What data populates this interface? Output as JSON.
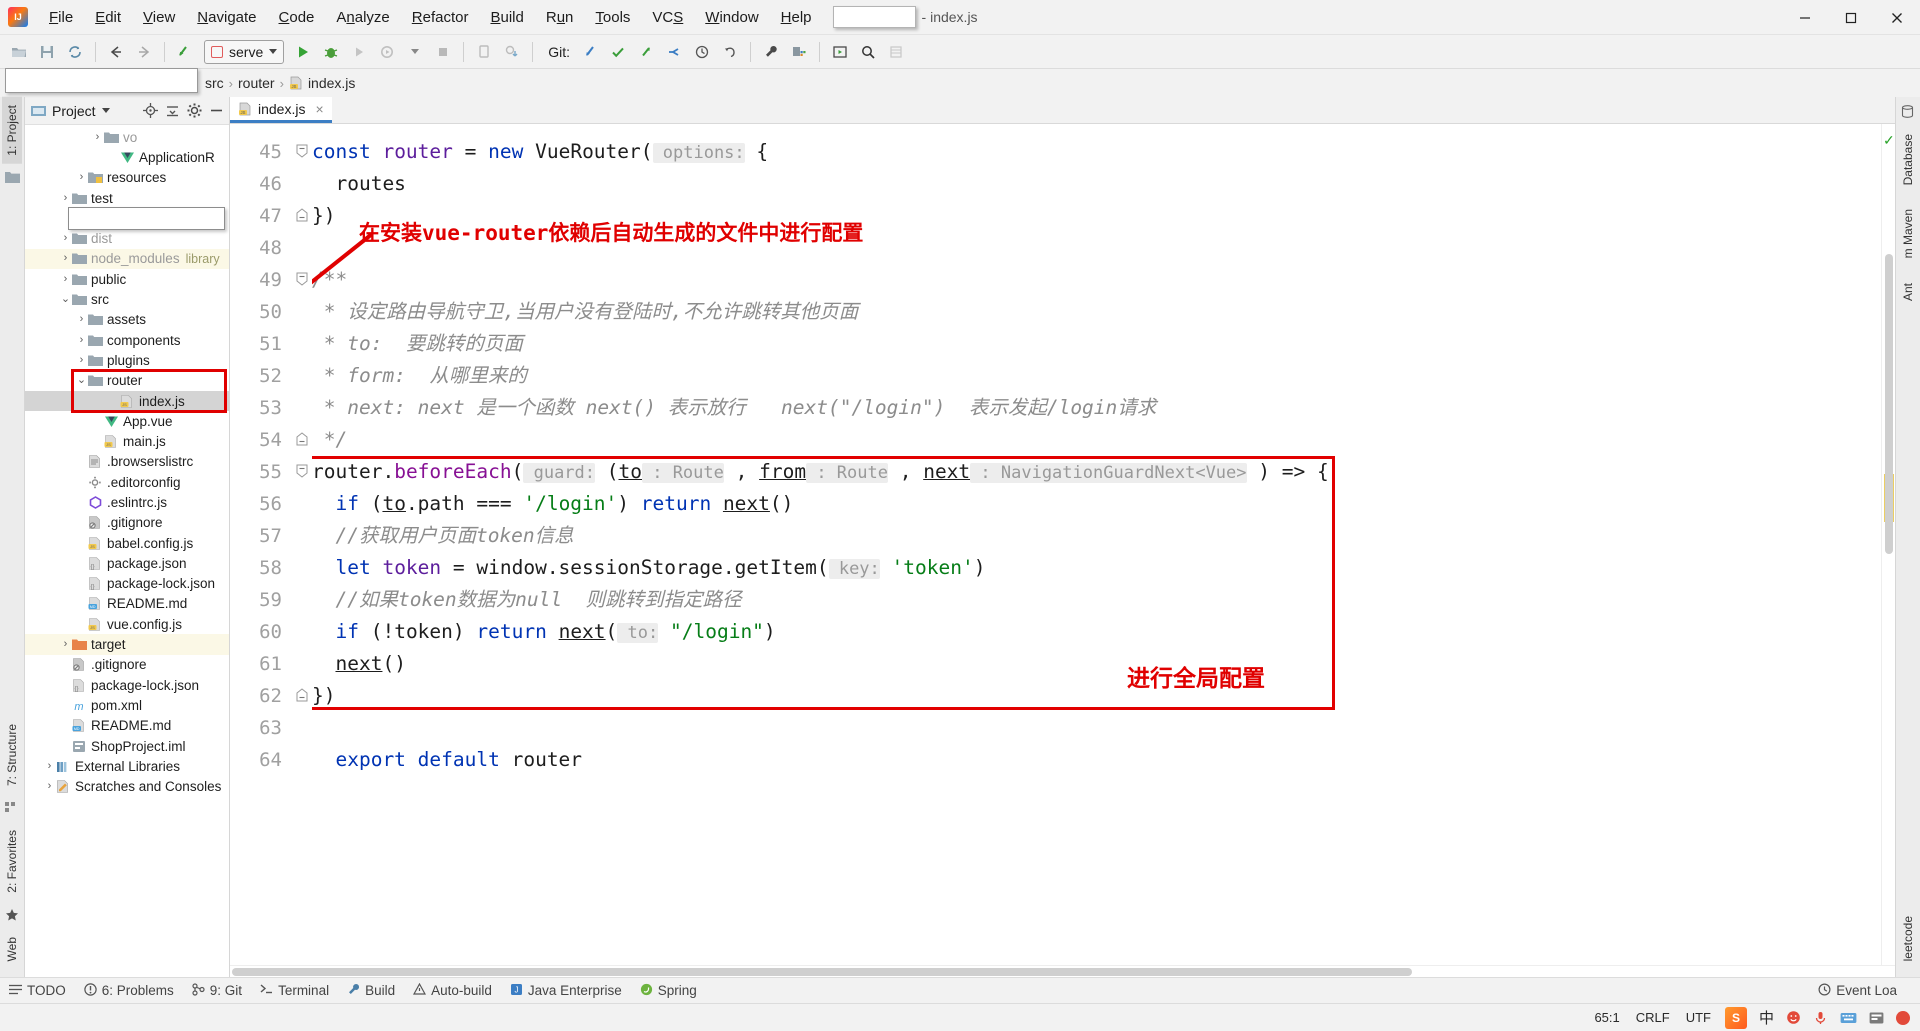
{
  "titlebar": {
    "logo_name": "intellij-idea-logo",
    "menus": [
      "File",
      "Edit",
      "View",
      "Navigate",
      "Code",
      "Analyze",
      "Refactor",
      "Build",
      "Run",
      "Tools",
      "VCS",
      "Window",
      "Help"
    ],
    "project_name_redacted": "",
    "title_suffix": "- index.js",
    "window_buttons": [
      "minimize",
      "maximize",
      "close"
    ]
  },
  "toolbar": {
    "run_config": "serve",
    "git_label": "Git:",
    "buttons": [
      "open-folder",
      "save-all",
      "sync",
      "back",
      "forward",
      "undo-arrow",
      "run",
      "debug",
      "run-coverage",
      "profile",
      "stop",
      "attach-debugger",
      "update-project",
      "commit",
      "update",
      "push",
      "history",
      "rollback",
      "settings-wrench",
      "project-structure",
      "terminal-run",
      "search-everywhere",
      "layout"
    ]
  },
  "breadcrumbs": {
    "redacted_field": "",
    "items": [
      "src",
      "router",
      "index.js"
    ],
    "separator": "›"
  },
  "left_strip": {
    "tabs": [
      "1: Project"
    ],
    "bottom_tabs": [
      "7: Structure",
      "2: Favorites"
    ],
    "web_tab": "Web"
  },
  "right_strip": {
    "tabs": [
      "Database",
      "m Maven",
      "Ant"
    ],
    "bottom_tabs": [
      "leetcode"
    ]
  },
  "project_panel": {
    "title": "Project",
    "header_icons": [
      "project-view-icon",
      "chevron-down-icon",
      "locate-icon",
      "collapse-all-icon",
      "settings-gear-icon",
      "hide-icon"
    ],
    "tree": [
      {
        "label": "vo",
        "indent": 4,
        "arrow": "›",
        "icon": "folder",
        "muted": true
      },
      {
        "label": "ApplicationR",
        "indent": 5,
        "arrow": "",
        "icon": "vue-green"
      },
      {
        "label": "resources",
        "indent": 3,
        "arrow": "›",
        "icon": "folder-res"
      },
      {
        "label": "test",
        "indent": 2,
        "arrow": "›",
        "icon": "folder"
      },
      {
        "label": "__REDACT__",
        "indent": 2,
        "arrow": "",
        "icon": "none"
      },
      {
        "label": "dist",
        "indent": 2,
        "arrow": "›",
        "icon": "folder",
        "muted": true
      },
      {
        "label": "node_modules",
        "indent": 2,
        "arrow": "›",
        "icon": "folder",
        "muted": true,
        "suffix": "library",
        "row_bg": "yellow"
      },
      {
        "label": "public",
        "indent": 2,
        "arrow": "›",
        "icon": "folder"
      },
      {
        "label": "src",
        "indent": 2,
        "arrow": "⌄",
        "icon": "folder"
      },
      {
        "label": "assets",
        "indent": 3,
        "arrow": "›",
        "icon": "folder"
      },
      {
        "label": "components",
        "indent": 3,
        "arrow": "›",
        "icon": "folder"
      },
      {
        "label": "plugins",
        "indent": 3,
        "arrow": "›",
        "icon": "folder"
      },
      {
        "label": "router",
        "indent": 3,
        "arrow": "⌄",
        "icon": "folder"
      },
      {
        "label": "index.js",
        "indent": 5,
        "arrow": "",
        "icon": "js",
        "selected": true
      },
      {
        "label": "App.vue",
        "indent": 4,
        "arrow": "",
        "icon": "vue"
      },
      {
        "label": "main.js",
        "indent": 4,
        "arrow": "",
        "icon": "js"
      },
      {
        "label": ".browserslistrc",
        "indent": 3,
        "arrow": "",
        "icon": "text"
      },
      {
        "label": ".editorconfig",
        "indent": 3,
        "arrow": "",
        "icon": "gear"
      },
      {
        "label": ".eslintrc.js",
        "indent": 3,
        "arrow": "",
        "icon": "eslint"
      },
      {
        "label": ".gitignore",
        "indent": 3,
        "arrow": "",
        "icon": "gitignore"
      },
      {
        "label": "babel.config.js",
        "indent": 3,
        "arrow": "",
        "icon": "js"
      },
      {
        "label": "package.json",
        "indent": 3,
        "arrow": "",
        "icon": "json"
      },
      {
        "label": "package-lock.json",
        "indent": 3,
        "arrow": "",
        "icon": "json"
      },
      {
        "label": "README.md",
        "indent": 3,
        "arrow": "",
        "icon": "md"
      },
      {
        "label": "vue.config.js",
        "indent": 3,
        "arrow": "",
        "icon": "js"
      },
      {
        "label": "target",
        "indent": 2,
        "arrow": "›",
        "icon": "folder-orange",
        "row_bg": "yellow"
      },
      {
        "label": ".gitignore",
        "indent": 2,
        "arrow": "",
        "icon": "gitignore"
      },
      {
        "label": "package-lock.json",
        "indent": 2,
        "arrow": "",
        "icon": "json"
      },
      {
        "label": "pom.xml",
        "indent": 2,
        "arrow": "",
        "icon": "maven"
      },
      {
        "label": "README.md",
        "indent": 2,
        "arrow": "",
        "icon": "md"
      },
      {
        "label": "ShopProject.iml",
        "indent": 2,
        "arrow": "",
        "icon": "iml"
      },
      {
        "label": "External Libraries",
        "indent": 1,
        "arrow": "›",
        "icon": "libs"
      },
      {
        "label": "Scratches and Consoles",
        "indent": 1,
        "arrow": "›",
        "icon": "scratch"
      }
    ]
  },
  "editor": {
    "tab": {
      "label": "index.js",
      "icon": "js-file-icon",
      "close": "×"
    },
    "first_line_number": 45,
    "lines": [
      {
        "n": 45,
        "fold": "start",
        "tokens": [
          {
            "t": "const ",
            "c": "kw"
          },
          {
            "t": "router",
            "c": "id"
          },
          {
            "t": " = ",
            "c": "plain"
          },
          {
            "t": "new ",
            "c": "kw"
          },
          {
            "t": "VueRouter",
            "c": "plain"
          },
          {
            "t": "(",
            "c": "plain"
          },
          {
            "t": " options:",
            "c": "hint"
          },
          {
            "t": " {",
            "c": "plain"
          }
        ]
      },
      {
        "n": 46,
        "tokens": [
          {
            "t": "  routes",
            "c": "plain"
          }
        ]
      },
      {
        "n": 47,
        "fold": "end",
        "tokens": [
          {
            "t": "})",
            "c": "plain"
          }
        ]
      },
      {
        "n": 48,
        "tokens": []
      },
      {
        "n": 49,
        "fold": "start",
        "tokens": [
          {
            "t": "/**",
            "c": "cmt"
          }
        ]
      },
      {
        "n": 50,
        "tokens": [
          {
            "t": " * 设定路由导航守卫,当用户没有登陆时,不允许跳转其他页面",
            "c": "cmt"
          }
        ]
      },
      {
        "n": 51,
        "tokens": [
          {
            "t": " * to:  要跳转的页面",
            "c": "cmt"
          }
        ]
      },
      {
        "n": 52,
        "tokens": [
          {
            "t": " * form:  从哪里来的",
            "c": "cmt"
          }
        ]
      },
      {
        "n": 53,
        "tokens": [
          {
            "t": " * next: next 是一个函数 next() 表示放行   next(\"/login\")  表示发起/login请求",
            "c": "cmt"
          }
        ]
      },
      {
        "n": 54,
        "fold": "end",
        "tokens": [
          {
            "t": " */",
            "c": "cmt"
          }
        ]
      },
      {
        "n": 55,
        "fold": "start",
        "tokens": [
          {
            "t": "router",
            "c": "plain"
          },
          {
            "t": ".",
            "c": "plain"
          },
          {
            "t": "beforeEach",
            "c": "purple"
          },
          {
            "t": "(",
            "c": "plain"
          },
          {
            "t": " guard:",
            "c": "hint"
          },
          {
            "t": " (",
            "c": "plain"
          },
          {
            "t": "to",
            "c": "und"
          },
          {
            "t": " : Route",
            "c": "hint"
          },
          {
            "t": " , ",
            "c": "plain"
          },
          {
            "t": "from",
            "c": "und"
          },
          {
            "t": " : Route",
            "c": "hint"
          },
          {
            "t": " , ",
            "c": "plain"
          },
          {
            "t": "next",
            "c": "und"
          },
          {
            "t": " : NavigationGuardNext<Vue>",
            "c": "hint"
          },
          {
            "t": " ) => {",
            "c": "plain"
          }
        ]
      },
      {
        "n": 56,
        "tokens": [
          {
            "t": "  ",
            "c": "plain"
          },
          {
            "t": "if",
            "c": "kw"
          },
          {
            "t": " (",
            "c": "plain"
          },
          {
            "t": "to",
            "c": "und"
          },
          {
            "t": ".path === ",
            "c": "plain"
          },
          {
            "t": "'/login'",
            "c": "str"
          },
          {
            "t": ") ",
            "c": "plain"
          },
          {
            "t": "return ",
            "c": "kw"
          },
          {
            "t": "next",
            "c": "und"
          },
          {
            "t": "()",
            "c": "plain"
          }
        ]
      },
      {
        "n": 57,
        "tokens": [
          {
            "t": "  //获取用户页面token信息",
            "c": "cmt"
          }
        ]
      },
      {
        "n": 58,
        "tokens": [
          {
            "t": "  ",
            "c": "plain"
          },
          {
            "t": "let ",
            "c": "kw"
          },
          {
            "t": "token",
            "c": "id"
          },
          {
            "t": " = window.sessionStorage.",
            "c": "plain"
          },
          {
            "t": "getItem",
            "c": "plain"
          },
          {
            "t": "(",
            "c": "plain"
          },
          {
            "t": " key:",
            "c": "hint"
          },
          {
            "t": " ",
            "c": "plain"
          },
          {
            "t": "'token'",
            "c": "str"
          },
          {
            "t": ")",
            "c": "plain"
          }
        ]
      },
      {
        "n": 59,
        "tokens": [
          {
            "t": "  //如果token数据为null  则跳转到指定路径",
            "c": "cmt"
          }
        ]
      },
      {
        "n": 60,
        "tokens": [
          {
            "t": "  ",
            "c": "plain"
          },
          {
            "t": "if",
            "c": "kw"
          },
          {
            "t": " (!",
            "c": "plain"
          },
          {
            "t": "token",
            "c": "plain"
          },
          {
            "t": ") ",
            "c": "plain"
          },
          {
            "t": "return ",
            "c": "kw"
          },
          {
            "t": "next",
            "c": "und"
          },
          {
            "t": "(",
            "c": "plain"
          },
          {
            "t": " to:",
            "c": "hint"
          },
          {
            "t": " ",
            "c": "plain"
          },
          {
            "t": "\"/login\"",
            "c": "str"
          },
          {
            "t": ")",
            "c": "plain"
          }
        ]
      },
      {
        "n": 61,
        "tokens": [
          {
            "t": "  ",
            "c": "plain"
          },
          {
            "t": "next",
            "c": "und"
          },
          {
            "t": "()",
            "c": "plain"
          }
        ]
      },
      {
        "n": 62,
        "fold": "end",
        "tokens": [
          {
            "t": "})",
            "c": "plain"
          }
        ]
      },
      {
        "n": 63,
        "tokens": []
      },
      {
        "n": 64,
        "tokens": [
          {
            "t": "  export default ",
            "c": "kw"
          },
          {
            "t": "router",
            "c": "plain"
          }
        ]
      }
    ],
    "annotations": [
      {
        "id": "annot-top",
        "text": "在安装vue-router依赖后自动生成的文件中进行配置"
      },
      {
        "id": "annot-bottom",
        "text": "进行全局配置"
      }
    ],
    "inspection_status": "✓"
  },
  "tool_window_bar": {
    "items": [
      {
        "icon": "todo-icon",
        "label": "TODO"
      },
      {
        "icon": "problems-icon",
        "label": "6: Problems"
      },
      {
        "icon": "git-icon",
        "label": "9: Git"
      },
      {
        "icon": "terminal-icon",
        "label": "Terminal"
      },
      {
        "icon": "build-icon",
        "label": "Build"
      },
      {
        "icon": "autobuild-icon",
        "label": "Auto-build"
      },
      {
        "icon": "java-icon",
        "label": "Java Enterprise"
      },
      {
        "icon": "spring-icon",
        "label": "Spring"
      }
    ],
    "event_log": {
      "icon": "event-log-icon",
      "label": "Event Loa"
    }
  },
  "statusbar": {
    "caret_position": "65:1",
    "line_separator": "CRLF",
    "encoding": "UTF",
    "ime": {
      "app": "S",
      "lang": "中",
      "items": [
        "smiley",
        "mic",
        "keyboard",
        "panel",
        "record"
      ]
    }
  }
}
